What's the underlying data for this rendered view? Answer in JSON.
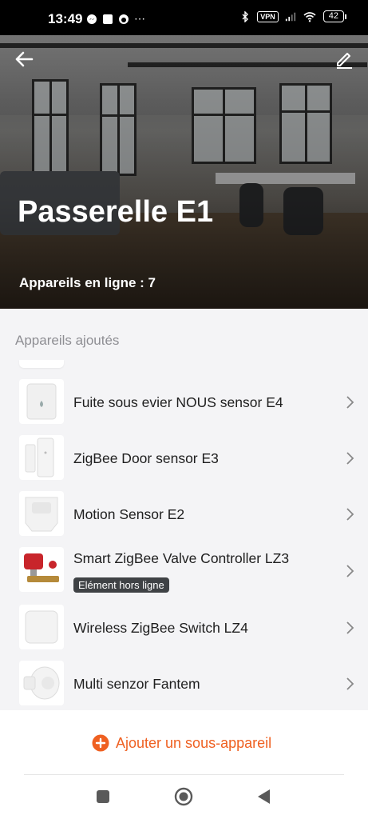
{
  "status_bar": {
    "time": "13:49",
    "vpn": "VPN",
    "battery": "42",
    "icons_left": [
      "messenger-icon",
      "square-notification-icon",
      "app-icon",
      "more-dots-icon"
    ],
    "icons_right": [
      "bluetooth-icon",
      "vpn-icon",
      "signal-icon",
      "wifi-icon",
      "battery-icon"
    ]
  },
  "header": {
    "title": "Passerelle E1",
    "online_label": "Appareils en ligne : 7",
    "back_icon": "arrow-left-icon",
    "edit_icon": "pencil-icon"
  },
  "section": {
    "label": "Appareils ajoutés"
  },
  "devices": [
    {
      "name": "Fuite sous evier NOUS sensor E4",
      "thumb": "water-leak-sensor"
    },
    {
      "name": "ZigBee Door sensor E3",
      "thumb": "door-sensor"
    },
    {
      "name": "Motion Sensor E2",
      "thumb": "motion-sensor"
    },
    {
      "name": "Smart ZigBee Valve Controller LZ3",
      "thumb": "valve-controller",
      "badge": "Elément hors ligne"
    },
    {
      "name": "Wireless ZigBee Switch LZ4",
      "thumb": "wireless-switch"
    },
    {
      "name": "Multi senzor Fantem",
      "thumb": "multi-sensor"
    }
  ],
  "footer": {
    "add_label": "Ajouter un sous-appareil"
  },
  "colors": {
    "accent": "#ef6021",
    "badge_bg": "#3f4245",
    "background": "#f4f4f6"
  },
  "nav": [
    "recents-square-icon",
    "home-circle-icon",
    "back-triangle-icon"
  ]
}
